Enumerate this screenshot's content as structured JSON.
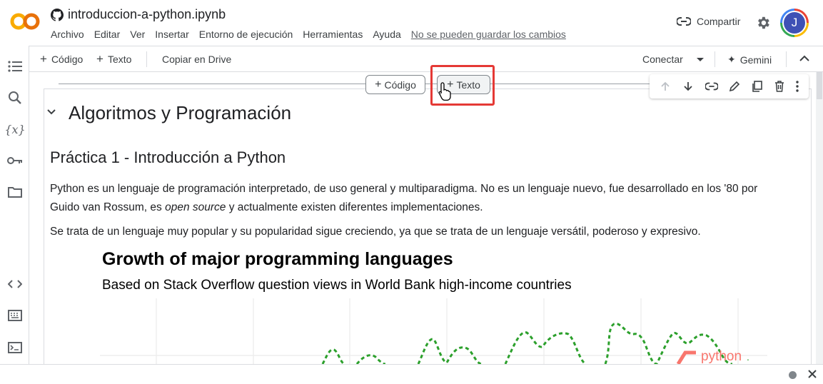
{
  "header": {
    "logo_text": "CO",
    "filename": "introduccion-a-python.ipynb",
    "menu": [
      "Archivo",
      "Editar",
      "Ver",
      "Insertar",
      "Entorno de ejecución",
      "Herramientas",
      "Ayuda"
    ],
    "unsaved_notice": "No se pueden guardar los cambios",
    "share_label": "Compartir",
    "avatar_initial": "J"
  },
  "toolbar": {
    "add_code": "Código",
    "add_text": "Texto",
    "copy_drive": "Copiar en Drive",
    "connect": "Conectar",
    "gemini": "Gemini"
  },
  "insert_bar": {
    "code_label": "Código",
    "text_label": "Texto"
  },
  "cell": {
    "heading": "Algoritmos y Programación",
    "subheading": "Práctica 1 - Introducción a Python",
    "para1_part1": "Python es un lenguaje de programación interpretado, de uso general y multiparadigma. No es un lenguaje nuevo, fue desarrollado en los '80 por",
    "para1_part2a": "Guido van Rossum, es ",
    "para1_em": "open source",
    "para1_part2b": " y actualmente existen diferentes implementaciones.",
    "para2": "Se trata de un lenguaje muy popular y su popularidad sigue creciendo, ya que se trata de un lenguaje versátil, poderoso y expresivo."
  },
  "chart_image": {
    "title": "Growth of major programming languages",
    "subtitle": "Based on Stack Overflow question views in World Bank high-income countries",
    "series_label": "python"
  },
  "colors": {
    "accent_red": "#e53935",
    "python_green": "#2ca02c",
    "python_label": "#f8766d",
    "logo_orange": "#f9ab00"
  }
}
